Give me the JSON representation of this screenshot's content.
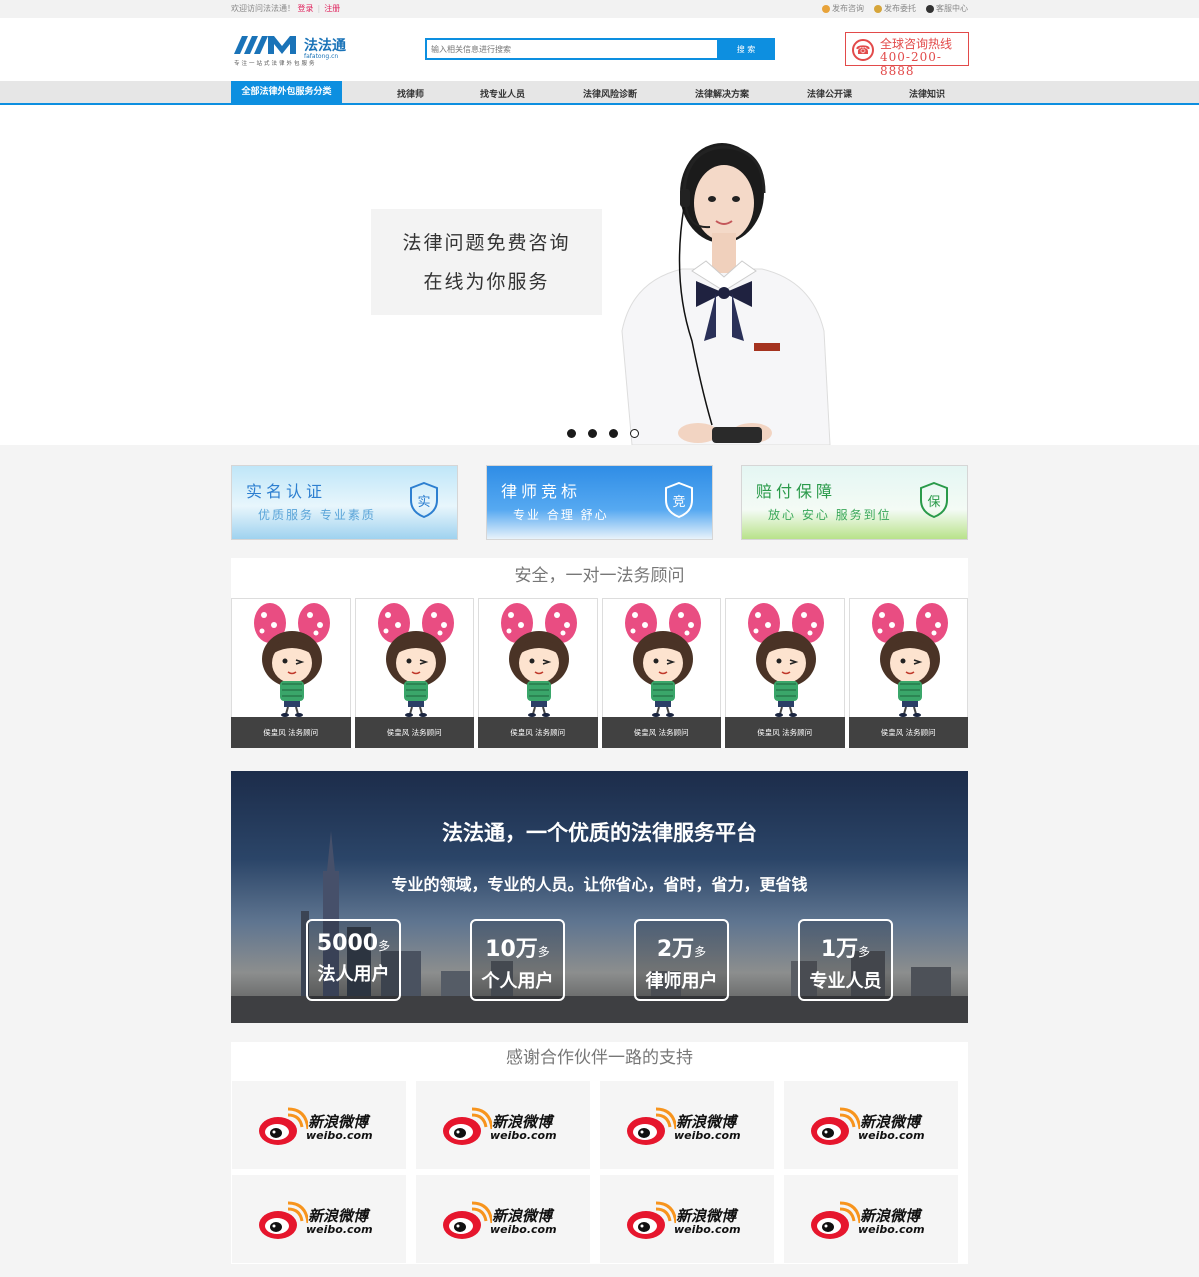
{
  "topbar": {
    "welcome": "欢迎访问法法通！",
    "login": "登录",
    "register": "注册",
    "links": [
      "发布咨询",
      "发布委托",
      "客服中心"
    ]
  },
  "header": {
    "logo_text": "法法通",
    "logo_domain": "fafatong.cn",
    "logo_slogan": "专注一站式法律外包服务",
    "search_placeholder": "输入相关信息进行搜索",
    "search_button": "搜 索",
    "hotline_title": "全球咨询热线",
    "hotline_number": "400-200-8888"
  },
  "nav": {
    "all_label": "全部法律外包服务分类",
    "items": [
      "找律师",
      "找专业人员",
      "法律风险诊断",
      "法律解决方案",
      "法律公开课",
      "法律知识"
    ]
  },
  "banner": {
    "line1": "法律问题免费咨询",
    "line2": "在线为你服务",
    "slides": 4,
    "active_slide": 4
  },
  "features": [
    {
      "title": "实名认证",
      "subtitle": "优质服务 专业素质",
      "badge": "实",
      "color": "#2d7fd0"
    },
    {
      "title": "律师竞标",
      "subtitle": "专业 合理 舒心",
      "badge": "竞",
      "color": "#ffffff"
    },
    {
      "title": "赔付保障",
      "subtitle": "放心 安心 服务到位",
      "badge": "保",
      "color": "#2a9a4a"
    }
  ],
  "advisors": {
    "title": "安全，一对一法务顾问",
    "items": [
      "侯皇风 法务顾问",
      "侯皇风 法务顾问",
      "侯皇风 法务顾问",
      "侯皇风 法务顾问",
      "侯皇风 法务顾问",
      "侯皇风 法务顾问"
    ]
  },
  "platform": {
    "title": "法法通，一个优质的法律服务平台",
    "subtitle": "专业的领域，专业的人员。让你省心，省时，省力，更省钱",
    "stats": [
      {
        "num": "5000",
        "unit": "多",
        "label": "法人用户"
      },
      {
        "num": "10万",
        "unit": "多",
        "label": "个人用户"
      },
      {
        "num": "2万",
        "unit": "多",
        "label": "律师用户"
      },
      {
        "num": "1万",
        "unit": "多",
        "label": "专业人员"
      }
    ]
  },
  "partners": {
    "title": "感谢合作伙伴一路的支持",
    "items": [
      {
        "cn": "新浪微博",
        "en": "weibo.com"
      },
      {
        "cn": "新浪微博",
        "en": "weibo.com"
      },
      {
        "cn": "新浪微博",
        "en": "weibo.com"
      },
      {
        "cn": "新浪微博",
        "en": "weibo.com"
      },
      {
        "cn": "新浪微博",
        "en": "weibo.com"
      },
      {
        "cn": "新浪微博",
        "en": "weibo.com"
      },
      {
        "cn": "新浪微博",
        "en": "weibo.com"
      },
      {
        "cn": "新浪微博",
        "en": "weibo.com"
      }
    ]
  }
}
